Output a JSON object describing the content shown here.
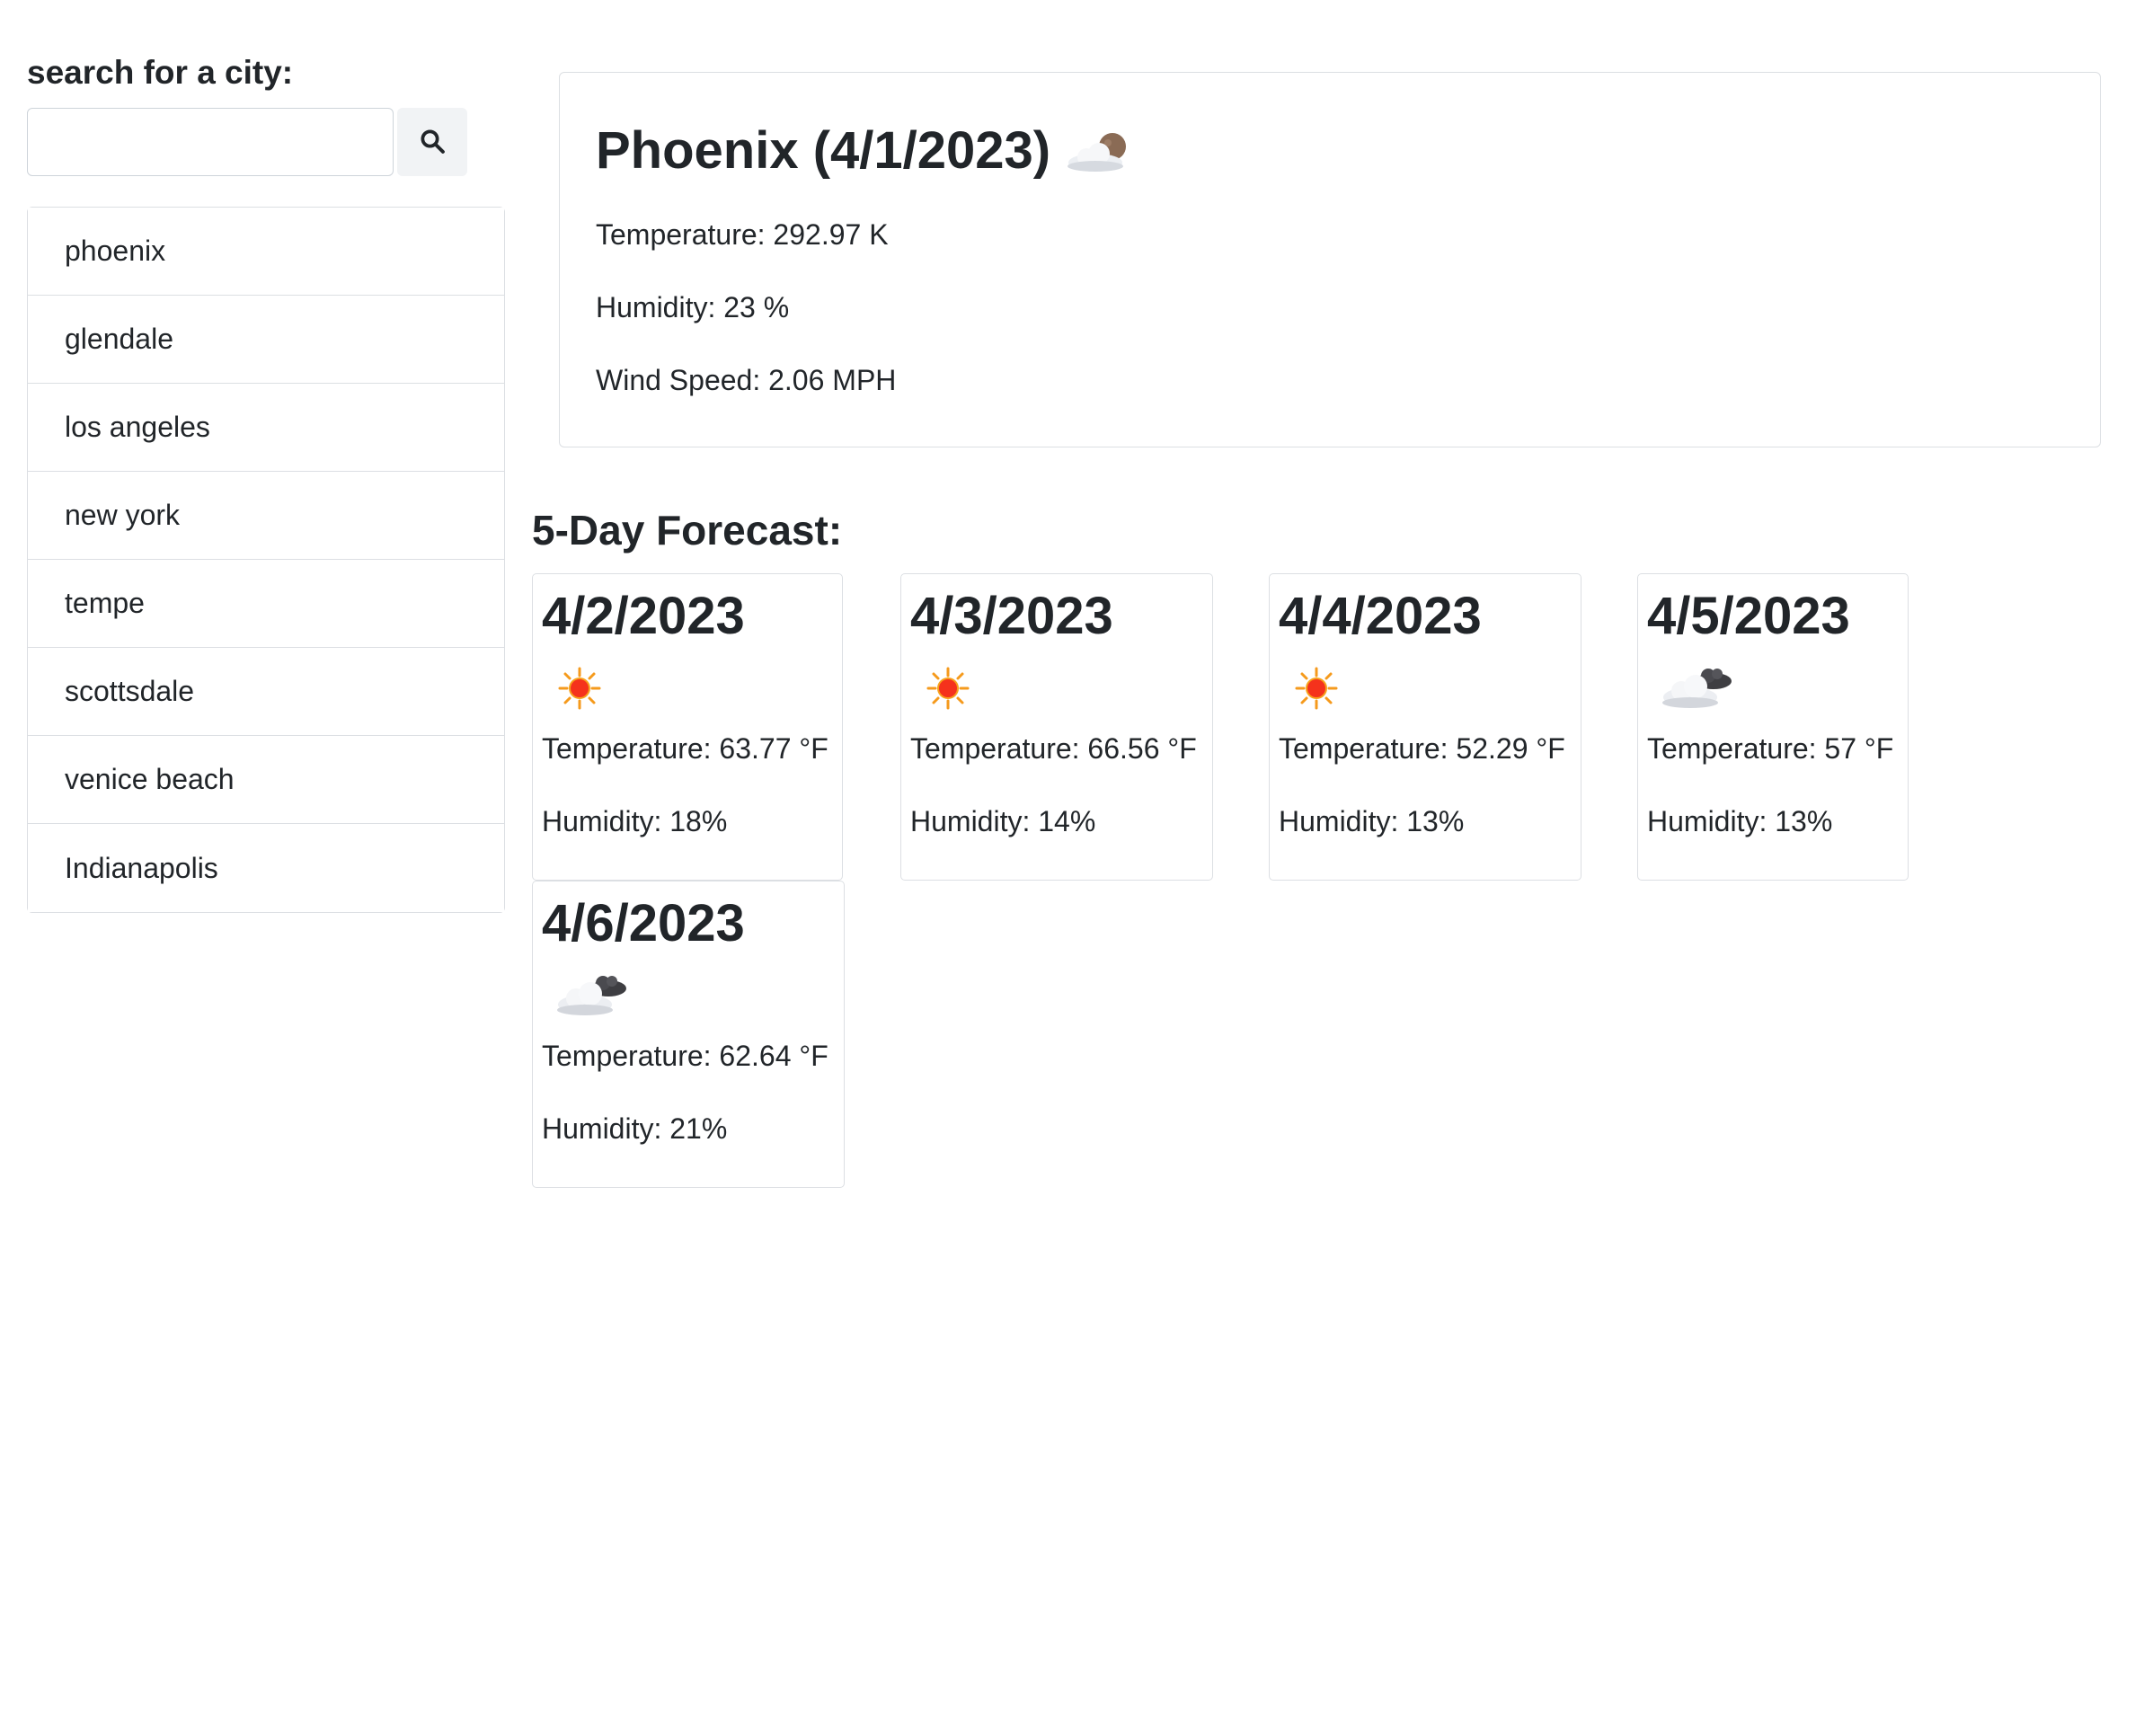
{
  "search": {
    "label": "search for a city:",
    "value": "",
    "placeholder": ""
  },
  "history": [
    "phoenix",
    "glendale",
    "los angeles",
    "new york",
    "tempe",
    "scottsdale",
    "venice beach",
    "Indianapolis"
  ],
  "current": {
    "title": "Phoenix (4/1/2023)",
    "icon": "cloud-moon-icon",
    "temperature": "Temperature: 292.97 K",
    "humidity": "Humidity: 23 %",
    "wind": "Wind Speed: 2.06 MPH"
  },
  "forecast": {
    "heading": "5-Day Forecast:",
    "days": [
      {
        "date": "4/2/2023",
        "icon": "sun-icon",
        "temperature": "Temperature: 63.77 °F",
        "humidity": "Humidity: 18%"
      },
      {
        "date": "4/3/2023",
        "icon": "sun-icon",
        "temperature": "Temperature: 66.56 °F",
        "humidity": "Humidity: 14%"
      },
      {
        "date": "4/4/2023",
        "icon": "sun-icon",
        "temperature": "Temperature: 52.29 °F",
        "humidity": "Humidity: 13%"
      },
      {
        "date": "4/5/2023",
        "icon": "cloudy-icon",
        "temperature": "Temperature: 57 °F",
        "humidity": "Humidity: 13%"
      },
      {
        "date": "4/6/2023",
        "icon": "cloudy-icon",
        "temperature": "Temperature: 62.64 °F",
        "humidity": "Humidity: 21%"
      }
    ]
  }
}
